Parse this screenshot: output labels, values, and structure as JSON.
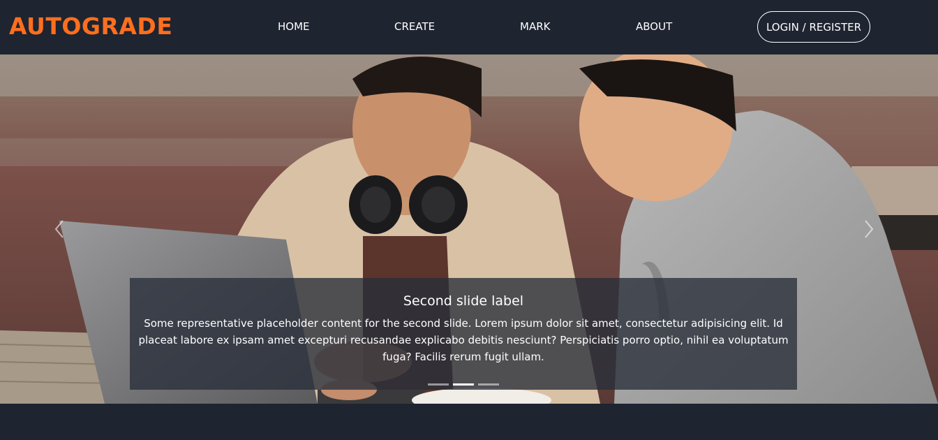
{
  "brand": {
    "name": "AUTOGRADE",
    "color": "#fb6f1e"
  },
  "nav": {
    "items": [
      {
        "label": "HOME"
      },
      {
        "label": "CREATE"
      },
      {
        "label": "MARK"
      },
      {
        "label": "ABOUT"
      }
    ],
    "login_label": "LOGIN / REGISTER"
  },
  "carousel": {
    "image_description_icon": "photo-two-students-laptop",
    "prev_icon": "chevron-left-icon",
    "next_icon": "chevron-right-icon",
    "caption": {
      "title": "Second slide label",
      "text": "Some representative placeholder content for the second slide. Lorem ipsum dolor sit amet, consectetur adipisicing elit. Id placeat labore ex ipsam amet excepturi recusandae explicabo debitis nesciunt? Perspiciatis porro optio, nihil ea voluptatum fuga? Facilis rerum fugit ullam."
    },
    "slide_count": 3,
    "active_slide": 2
  },
  "colors": {
    "background": "#1e2430",
    "accent": "#fb6f1e",
    "text": "#ffffff"
  }
}
